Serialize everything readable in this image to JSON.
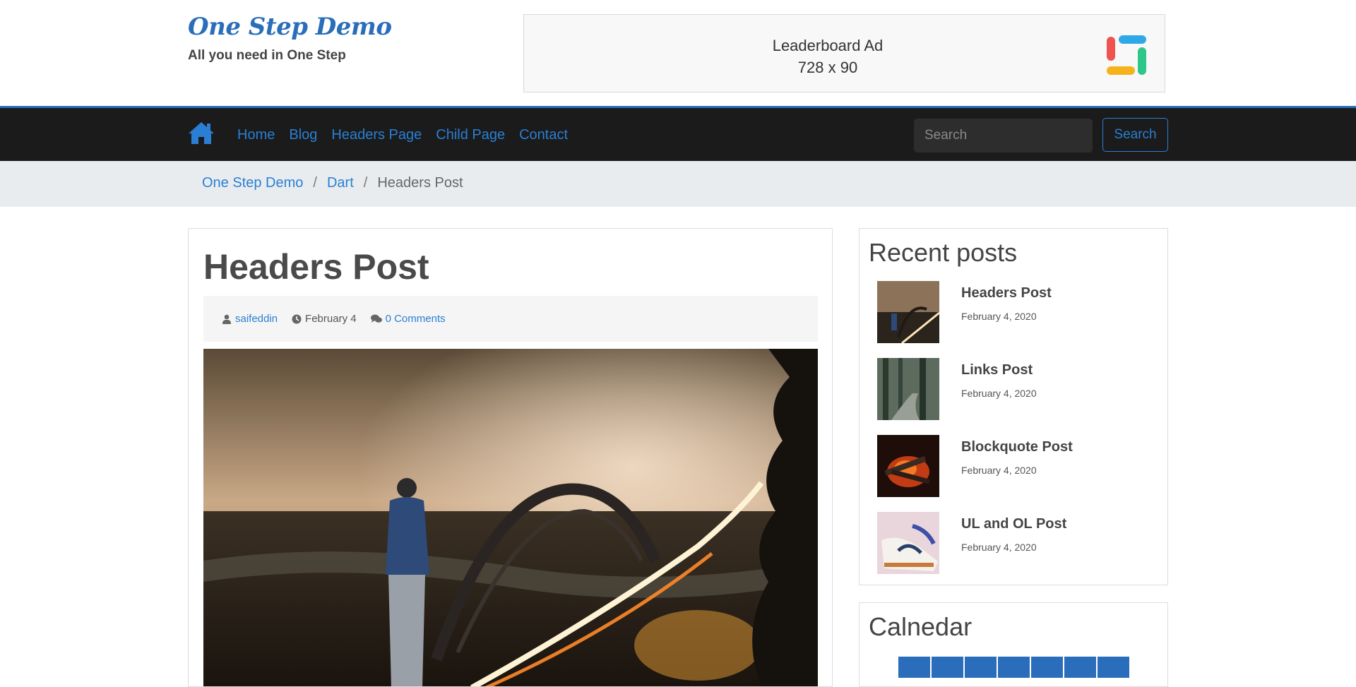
{
  "brand": {
    "title": "One Step Demo",
    "tagline": "All you need in One Step"
  },
  "ad": {
    "line1": "Leaderboard Ad",
    "line2": "728 x 90",
    "logo_icon": "leaderboard-logo-icon"
  },
  "nav": {
    "home_icon": "home-icon",
    "links": [
      {
        "label": "Home"
      },
      {
        "label": "Blog"
      },
      {
        "label": "Headers Page"
      },
      {
        "label": "Child Page"
      },
      {
        "label": "Contact"
      }
    ],
    "search_placeholder": "Search",
    "search_button": "Search"
  },
  "breadcrumb": {
    "items": [
      {
        "label": "One Step Demo"
      },
      {
        "label": "Dart"
      }
    ],
    "separator": "/",
    "current": "Headers Post"
  },
  "post": {
    "title": "Headers Post",
    "author": "saifeddin",
    "date": "February 4",
    "comments": "0 Comments",
    "image_icon": "bridge-night-photo"
  },
  "sidebar": {
    "recent_title": "Recent posts",
    "recent_posts": [
      {
        "title": "Headers Post",
        "date": "February 4, 2020"
      },
      {
        "title": "Links Post",
        "date": "February 4, 2020"
      },
      {
        "title": "Blockquote Post",
        "date": "February 4, 2020"
      },
      {
        "title": "UL and OL Post",
        "date": "February 4, 2020"
      }
    ],
    "calendar_title": "Calnedar"
  },
  "colors": {
    "accent": "#2a6ebb",
    "link": "#2a7fd4",
    "navbar_bg": "#1b1b1b",
    "breadcrumb_bg": "#e9ecef"
  }
}
